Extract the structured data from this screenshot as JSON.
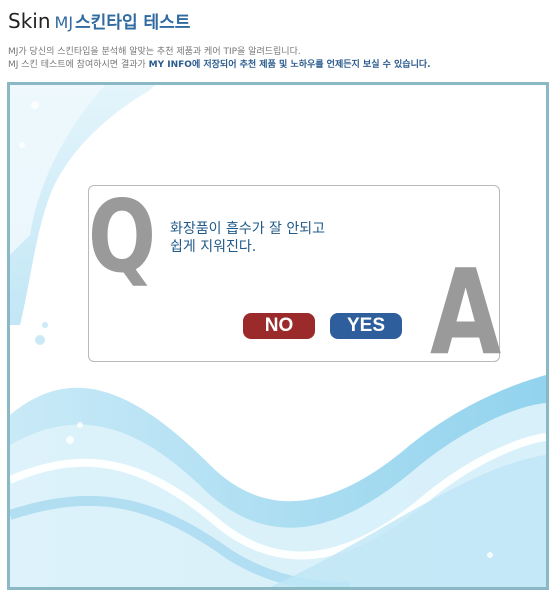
{
  "header": {
    "title_skin": "Skin",
    "title_mj": "MJ",
    "title_korean": "스킨타입 테스트",
    "desc_line1": "MJ가 당신의 스킨타입을 분석해 알맞는 추천 제품과 케어 TIP을 알려드립니다.",
    "desc_line2_prefix": "MJ 스킨 테스트에 참여하시면 결과가 ",
    "desc_line2_highlight": "MY INFO에 저장되어 추천 제품 및 노하우를 언제든지 보실 수 있습니다."
  },
  "quiz": {
    "q_letter": "Q",
    "a_letter": "A",
    "question_line1": "화장품이 흡수가 잘 안되고",
    "question_line2": "쉽게 지워진다.",
    "no_label": "NO",
    "yes_label": "YES"
  },
  "colors": {
    "accent_blue": "#2f6aa0",
    "no_button": "#9b2a2a",
    "yes_button": "#2e5e9c",
    "frame_border": "#8ab8c4",
    "letter_gray": "#9a9a9a"
  }
}
